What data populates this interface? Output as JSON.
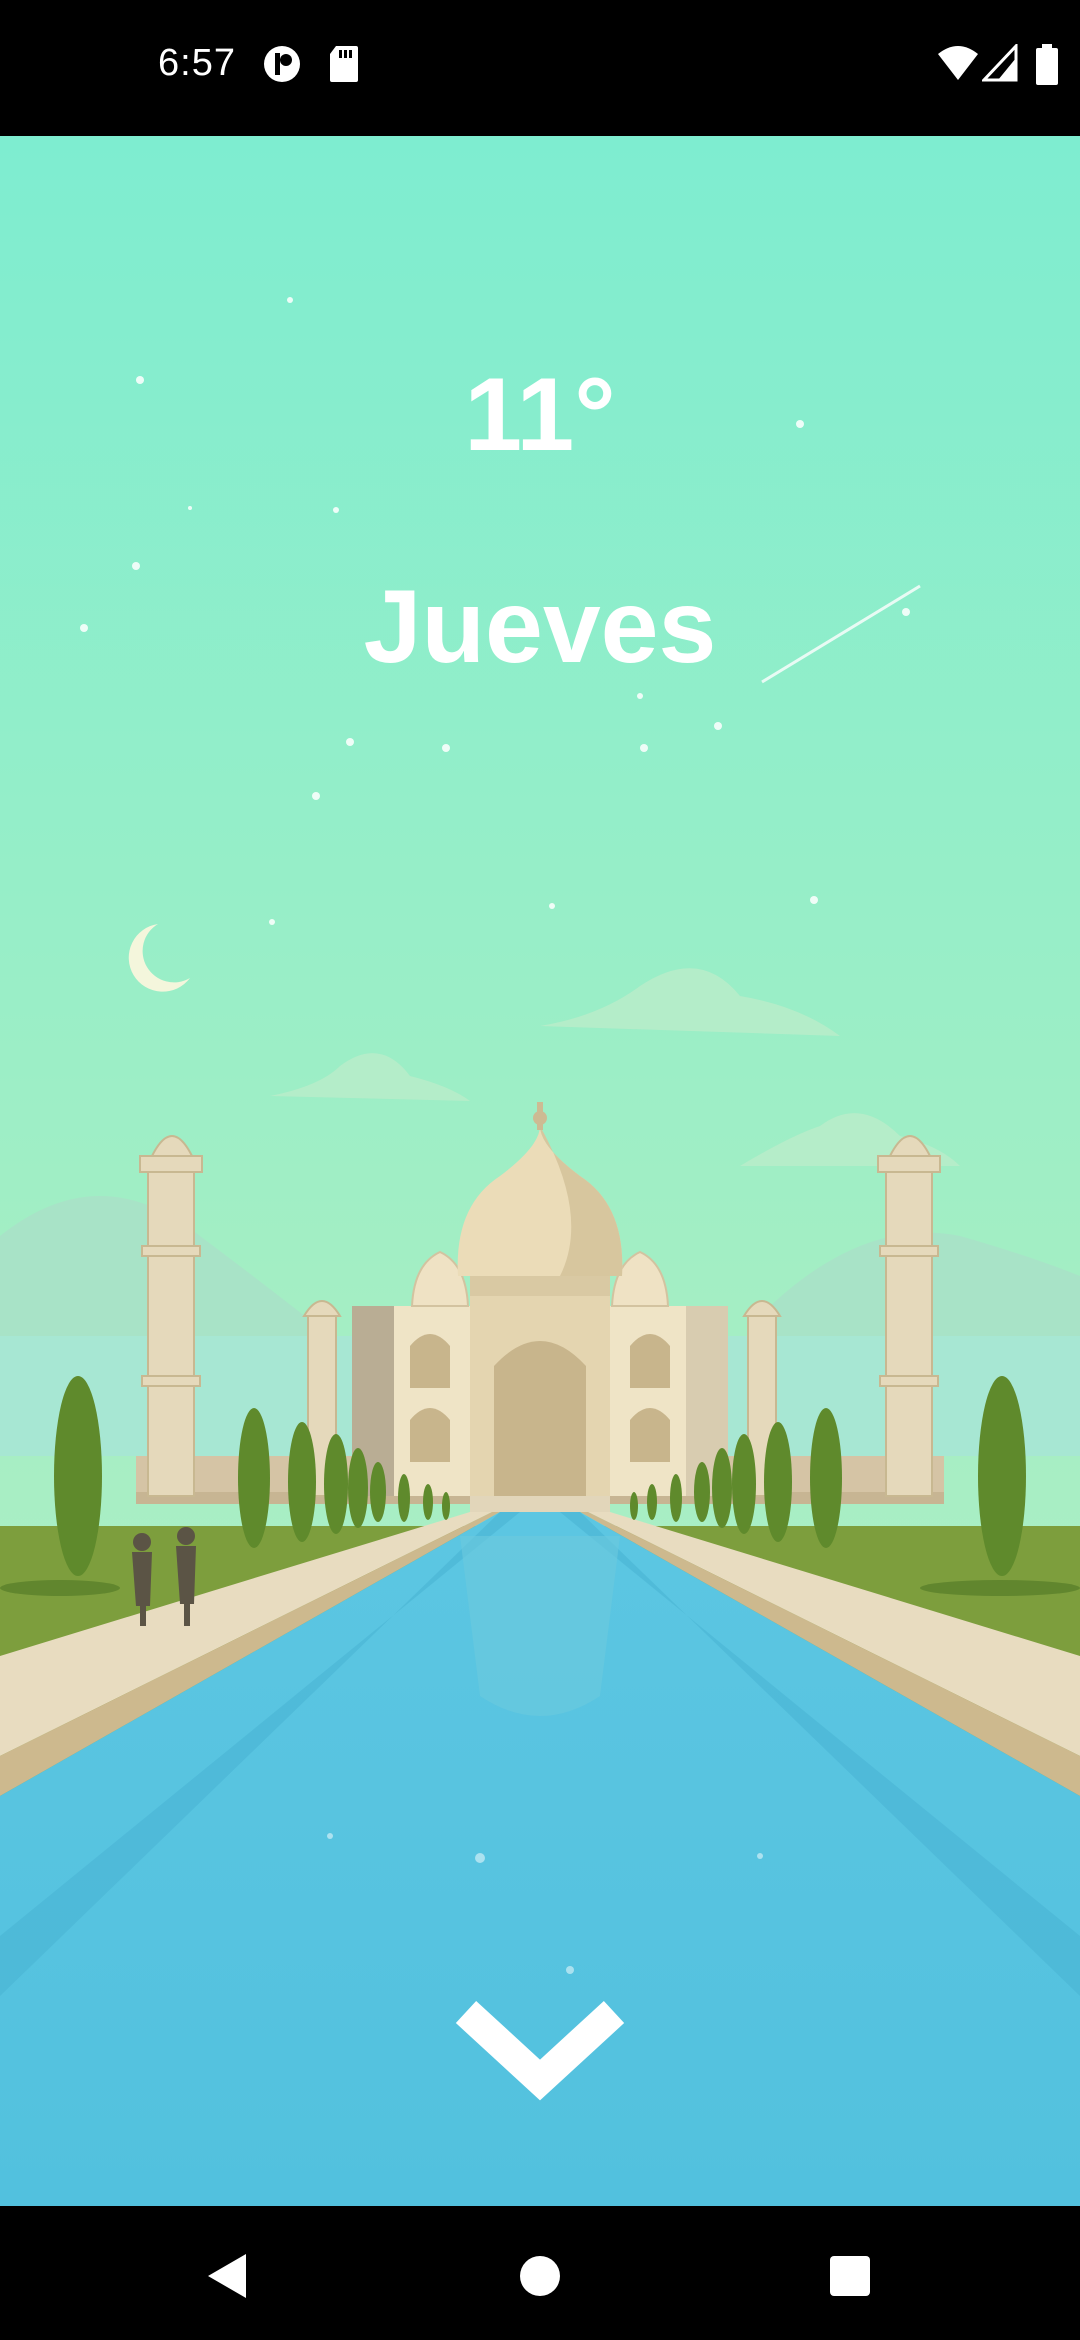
{
  "status_bar": {
    "time": "6:57",
    "icons": [
      "privacy-app-icon",
      "sd-card-icon",
      "wifi-icon",
      "cell-signal-icon",
      "battery-icon"
    ]
  },
  "weather": {
    "temperature": "11°",
    "day": "Jueves"
  },
  "scroll_hint": {
    "icon": "chevron-down-icon"
  },
  "navigation_bar": {
    "buttons": [
      "back-icon",
      "home-icon",
      "recents-icon"
    ]
  },
  "colors": {
    "sky_top": "#7eedd0",
    "sky_bottom": "#b4efc0",
    "water": "#52c1de",
    "grass": "#7a9b3e",
    "path": "#e8dcc0"
  }
}
